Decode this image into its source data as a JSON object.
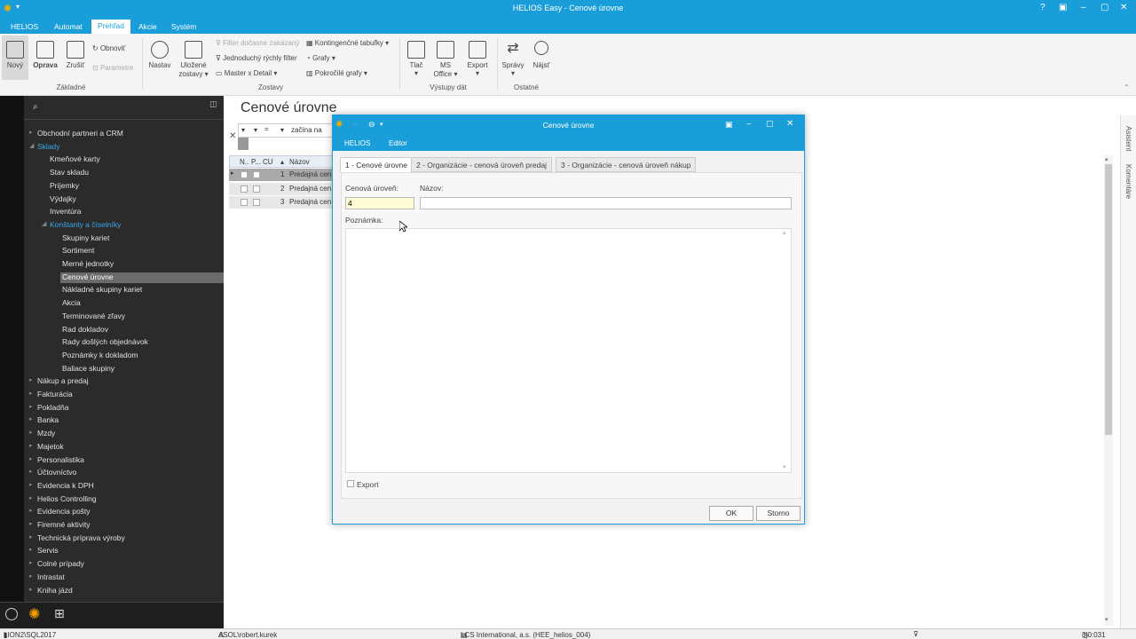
{
  "window": {
    "title": "HELIOS Easy - Cenové úrovne",
    "controls": [
      "?",
      "▣",
      "–",
      "▢",
      "✕"
    ]
  },
  "menu": {
    "tabs": [
      "HELIOS",
      "Automat",
      "Prehľad",
      "Akcie",
      "Systém"
    ],
    "active": "Prehľad"
  },
  "ribbon": {
    "zakladne": {
      "novy": "Nový",
      "oprava": "Oprava",
      "zrusit": "Zrušiť",
      "obnovit": "Obnoviť",
      "parametre": "Parametre",
      "group": "Základné"
    },
    "zostavy": {
      "nastav": "Nastav",
      "ulozene": "Uložené",
      "ulozene2": "zostavy",
      "filter": "Filter dočasne zakázaný",
      "rychly": "Jednoduchý rýchly filter",
      "master": "Master x Detail",
      "kontingencne": "Kontingenčné tabuľky",
      "grafy": "Grafy",
      "pokrocile": "Pokročilé grafy",
      "group": "Zostavy"
    },
    "vystupy": {
      "tlac": "Tlač",
      "ms": "MS",
      "office": "Office",
      "export": "Export",
      "group": "Výstupy dát"
    },
    "ostatne": {
      "spravy": "Správy",
      "najst": "Nájsť",
      "group": "Ostatné"
    }
  },
  "sidebar": {
    "items": [
      {
        "label": "Obchodní partneri a CRM",
        "level": 0
      },
      {
        "label": "Sklady",
        "level": 0,
        "blue": true,
        "open": true
      },
      {
        "label": "Kmeňové karty",
        "level": 1
      },
      {
        "label": "Stav skladu",
        "level": 1
      },
      {
        "label": "Príjemky",
        "level": 1
      },
      {
        "label": "Výdajky",
        "level": 1
      },
      {
        "label": "Inventúra",
        "level": 1
      },
      {
        "label": "Konštanty a číselníky",
        "level": 1,
        "blue": true,
        "open": true
      },
      {
        "label": "Skupiny kariet",
        "level": 2
      },
      {
        "label": "Sortiment",
        "level": 2
      },
      {
        "label": "Merné jednotky",
        "level": 2
      },
      {
        "label": "Cenové úrovne",
        "level": 2,
        "selected": true
      },
      {
        "label": "Nákladné skupiny kariet",
        "level": 2
      },
      {
        "label": "Akcia",
        "level": 2
      },
      {
        "label": "Terminované zľavy",
        "level": 2
      },
      {
        "label": "Rad dokladov",
        "level": 2
      },
      {
        "label": "Rady došlých objednávok",
        "level": 2
      },
      {
        "label": "Poznámky k dokladom",
        "level": 2
      },
      {
        "label": "Baliace skupiny",
        "level": 2
      },
      {
        "label": "Nákup a predaj",
        "level": 0
      },
      {
        "label": "Fakturácia",
        "level": 0
      },
      {
        "label": "Pokladňa",
        "level": 0
      },
      {
        "label": "Banka",
        "level": 0
      },
      {
        "label": "Mzdy",
        "level": 0
      },
      {
        "label": "Majetok",
        "level": 0
      },
      {
        "label": "Personalistika",
        "level": 0
      },
      {
        "label": "Účtovníctvo",
        "level": 0
      },
      {
        "label": "Evidencia k DPH",
        "level": 0
      },
      {
        "label": "Helios Controlling",
        "level": 0
      },
      {
        "label": "Evidencia pošty",
        "level": 0
      },
      {
        "label": "Firemné aktivity",
        "level": 0
      },
      {
        "label": "Technická príprava výroby",
        "level": 0
      },
      {
        "label": "Servis",
        "level": 0
      },
      {
        "label": "Colné prípady",
        "level": 0
      },
      {
        "label": "Intrastat",
        "level": 0
      },
      {
        "label": "Kniha jázd",
        "level": 0
      }
    ]
  },
  "main": {
    "title": "Cenové úrovne",
    "filter_text": "začína na",
    "columns": [
      "N..",
      "P...",
      "CU",
      "Názov"
    ],
    "rows": [
      {
        "cu": "1",
        "nazov": "Predajná cen"
      },
      {
        "cu": "2",
        "nazov": "Predajná cen"
      },
      {
        "cu": "3",
        "nazov": "Predajná cen"
      }
    ]
  },
  "rightrail": {
    "asistent": "Asistent",
    "komentare": "Komentáre"
  },
  "dialog": {
    "title": "Cenové úrovne",
    "menu": [
      "HELIOS",
      "Editor"
    ],
    "tabs": [
      "1 - Cenové úrovne",
      "2 - Organizácie - cenová úroveň predaj",
      "3 - Organizácie - cenová úroveň nákup"
    ],
    "fields": {
      "cenova_label": "Cenová úroveň:",
      "cenova_value": "4",
      "nazov_label": "Názov:",
      "nazov_value": "",
      "poznamka_label": "Poznámka:",
      "export_label": "Export"
    },
    "ok": "OK",
    "storno": "Storno"
  },
  "status": {
    "server": "LION2\\SQL2017",
    "user": "ASOL\\robert.kurek",
    "company": "LCS International, a.s. (HEE_helios_004)",
    "clock": "3|0:031"
  },
  "colors": {
    "accent": "#1a9ed9",
    "sidebar": "#2b2b2b",
    "link": "#3aa6e8"
  }
}
